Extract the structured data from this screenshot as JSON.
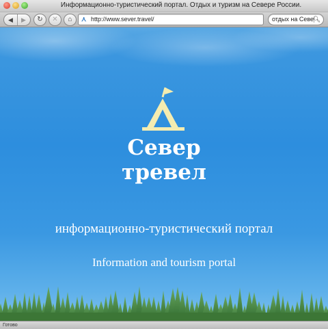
{
  "window": {
    "title": "Информационно-туристический портал. Отдых и туризм на Севере России."
  },
  "toolbar": {
    "back_icon": "back-arrow-icon",
    "forward_icon": "forward-arrow-icon",
    "reload_icon": "reload-icon",
    "stop_icon": "stop-icon",
    "home_icon": "home-icon",
    "url": "http://www.sever.travel/",
    "search_value": "отдых на Севере"
  },
  "page": {
    "logo_line1": "Север",
    "logo_line2": "тревел",
    "subtitle_ru": "информационно-туристический портал",
    "subtitle_en": "Information and tourism portal",
    "colors": {
      "sky": "#2d8ede",
      "logo_tent": "#f4ecb0",
      "text": "#ffffff",
      "trees": "#3f7a3a"
    }
  },
  "status": {
    "text": "Готово"
  }
}
